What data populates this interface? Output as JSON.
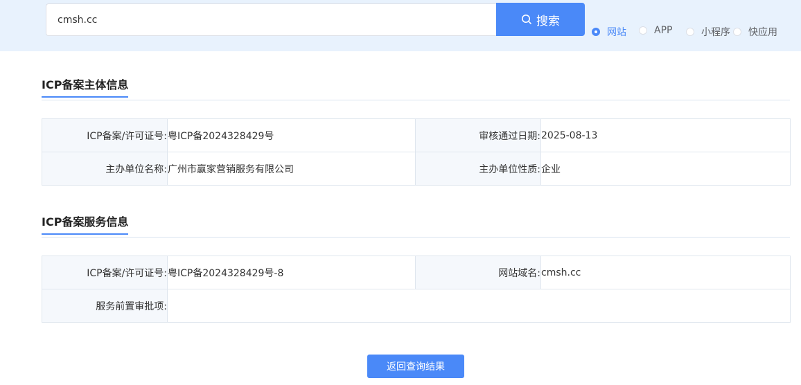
{
  "search": {
    "value": "cmsh.cc",
    "button_label": "搜索",
    "icon": "search-icon"
  },
  "type_options": [
    {
      "label": "网站",
      "checked": true
    },
    {
      "label": "APP",
      "checked": false
    },
    {
      "label": "小程序",
      "checked": false
    },
    {
      "label": "快应用",
      "checked": false
    }
  ],
  "subject_section": {
    "title": "ICP备案主体信息",
    "license_key": "ICP备案/许可证号:",
    "license_value": "粤ICP备2024328429号",
    "approve_date_key": "审核通过日期:",
    "approve_date_value": "2025-08-13",
    "org_name_key": "主办单位名称:",
    "org_name_value": "广州市赢家营销服务有限公司",
    "org_type_key": "主办单位性质:",
    "org_type_value": "企业"
  },
  "service_section": {
    "title": "ICP备案服务信息",
    "license_key": "ICP备案/许可证号:",
    "license_value": "粤ICP备2024328429号-8",
    "domain_key": "网站域名:",
    "domain_value": "cmsh.cc",
    "pre_approval_key": "服务前置审批项:",
    "pre_approval_value": ""
  },
  "back_button_label": "返回查询结果",
  "colors": {
    "accent": "#4a89f8",
    "band_background": "#e8f2fd",
    "key_cell_background": "#f5f8fc"
  }
}
